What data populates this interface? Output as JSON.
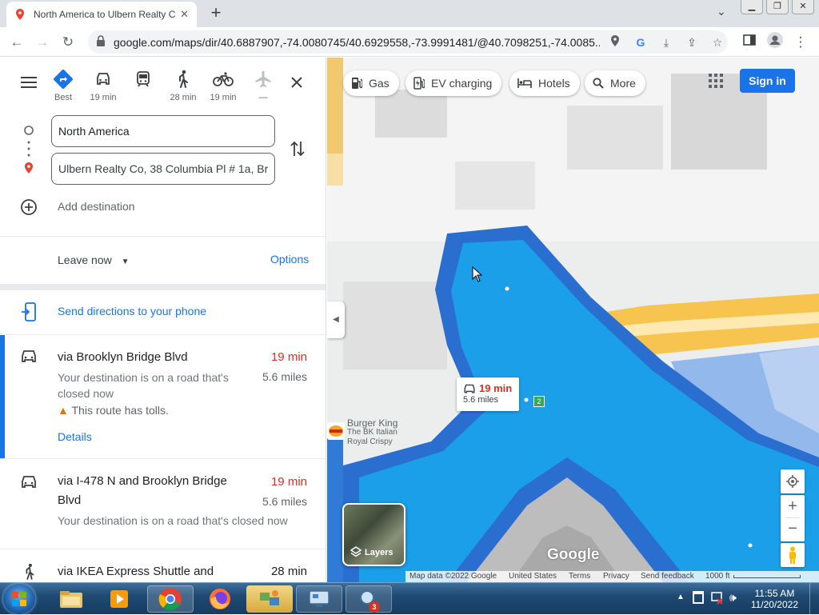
{
  "browser": {
    "tab_title": "North America to Ulbern Realty C",
    "url": "google.com/maps/dir/40.6887907,-74.0080745/40.6929558,-73.9991481/@40.7098251,-74.0085..."
  },
  "modes": [
    {
      "name": "best",
      "label": "Best"
    },
    {
      "name": "driving",
      "label": "19 min"
    },
    {
      "name": "transit",
      "label": ""
    },
    {
      "name": "walking",
      "label": "28 min"
    },
    {
      "name": "cycling",
      "label": "19 min"
    },
    {
      "name": "flight",
      "label": "—"
    }
  ],
  "directions": {
    "origin_value": "North America",
    "destination_value": "Ulbern Realty Co, 38 Columbia Pl # 1a, Br",
    "add_destination": "Add destination",
    "leave_now": "Leave now",
    "options": "Options",
    "send_to_phone": "Send directions to your phone"
  },
  "routes": [
    {
      "title": "via Brooklyn Bridge Blvd",
      "time": "19 min",
      "distance": "5.6 miles",
      "note_line1": "Your destination is on a road that's",
      "note_line2": "closed now",
      "toll": "This route has tolls.",
      "details": "Details"
    },
    {
      "title_line1": "via I-478 N and Brooklyn Bridge",
      "title_line2": "Blvd",
      "time": "19 min",
      "distance": "5.6 miles",
      "note": "Your destination is on a road that's closed now"
    },
    {
      "title": "via IKEA Express Shuttle and",
      "time": "28 min"
    }
  ],
  "map": {
    "chips": [
      "Gas",
      "EV charging",
      "Hotels",
      "More"
    ],
    "signin": "Sign in",
    "callout_time": "19 min",
    "callout_distance": "5.6 miles",
    "route_shield": "2",
    "poi_name": "Burger King",
    "poi_sub1": "The BK Italian",
    "poi_sub2": "Royal Crispy",
    "layers": "Layers",
    "google_logo": "Google",
    "footer": {
      "mapdata": "Map data ©2022 Google",
      "country": "United States",
      "terms": "Terms",
      "privacy": "Privacy",
      "feedback": "Send feedback",
      "scale": "1000 ft"
    }
  },
  "taskbar": {
    "time": "11:55 AM",
    "date": "11/20/2022",
    "badge": "3"
  },
  "colors": {
    "accent": "#1a73e8",
    "time_red": "#d93025",
    "water": "#1a9fe8"
  }
}
